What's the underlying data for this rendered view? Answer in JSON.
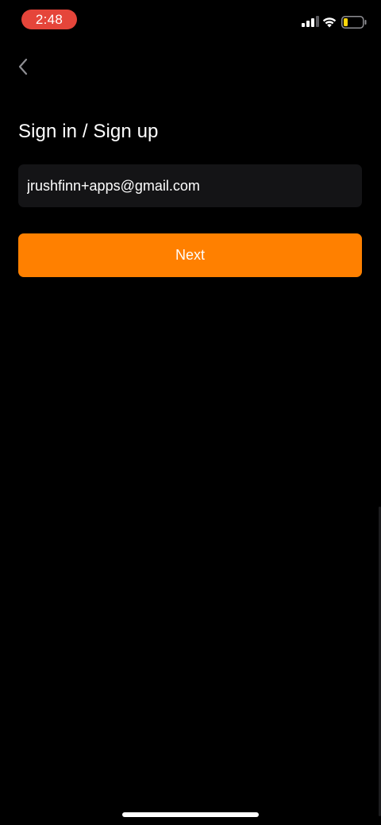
{
  "status_bar": {
    "time": "2:48",
    "time_pill_color": "#e5453a",
    "icons": [
      "signal-icon",
      "wifi-icon",
      "battery-icon"
    ]
  },
  "header": {
    "back_icon": "chevron-left-icon"
  },
  "form": {
    "title": "Sign in / Sign up",
    "email_value": "jrushfinn+apps@gmail.com",
    "next_label": "Next"
  },
  "colors": {
    "accent": "#ff8000",
    "background": "#000000",
    "field_background": "#141416"
  }
}
